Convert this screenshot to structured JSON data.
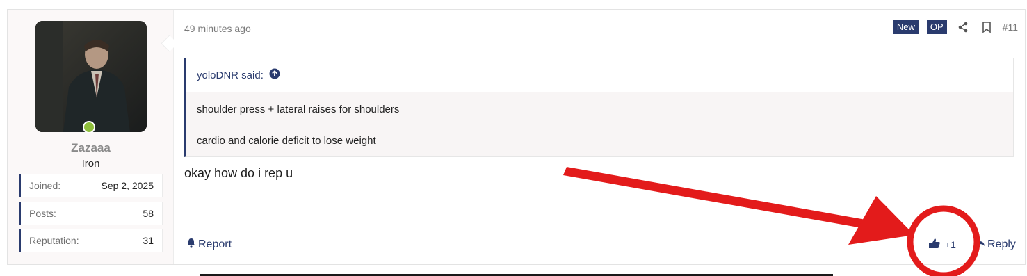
{
  "user": {
    "name": "Zazaaa",
    "title": "Iron",
    "stats": [
      {
        "key": "Joined:",
        "value": "Sep 2, 2025"
      },
      {
        "key": "Posts:",
        "value": "58"
      },
      {
        "key": "Reputation:",
        "value": "31"
      }
    ],
    "online_status_color": "#8fbf3c"
  },
  "post": {
    "time": "49 minutes ago",
    "badges": {
      "new": "New",
      "op": "OP"
    },
    "number": "#11",
    "quote": {
      "author_line": "yoloDNR said:",
      "lines": [
        "shoulder press + lateral raises for shoulders",
        "cardio and calorie deficit to lose weight"
      ]
    },
    "message": "okay how do i rep u",
    "actions": {
      "report": "Report",
      "reaction_count": "+1",
      "reply": "Reply"
    }
  },
  "icons": [
    "share-icon",
    "bookmark-icon",
    "arrow-up-circle-icon",
    "bell-icon",
    "thumbs-up-icon",
    "reply-icon"
  ],
  "colors": {
    "accent": "#2a3b6e",
    "annotation": "#e31b1b"
  }
}
